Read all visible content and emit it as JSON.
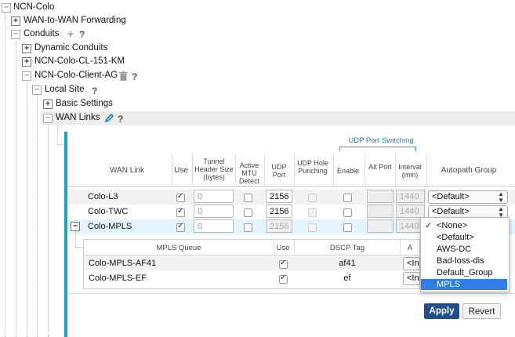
{
  "tree": {
    "root": "NCN-Colo",
    "wan_to_wan": "WAN-to-WAN Forwarding",
    "conduits": "Conduits",
    "dynamic_conduits": "Dynamic Conduits",
    "cl_151": "NCN-Colo-CL-151-KM",
    "client_ag": "NCN-Colo-Client-AG",
    "local_site": "Local Site",
    "basic_settings": "Basic Settings",
    "wan_links": "WAN Links",
    "help": "?",
    "plus": "+",
    "expand": "+",
    "collapse": "−"
  },
  "table": {
    "group_header": "UDP Port Switching",
    "headers": {
      "wan_link": "WAN Link",
      "use": "Use",
      "tunnel": "Tunnel Header Size (bytes)",
      "mtu": "Active MTU Detect",
      "udp_port": "UDP Port",
      "hole": "UDP Hole Punching",
      "enable": "Enable",
      "alt_port": "Alt Port",
      "interval": "Interval (min)",
      "autopath": "Autopath Group"
    },
    "rows": [
      {
        "name": "Colo-L3",
        "use": true,
        "tunnel": "0",
        "udp": "2156",
        "interval": "1440",
        "autopath": "<Default>"
      },
      {
        "name": "Colo-TWC",
        "use": true,
        "tunnel": "0",
        "udp": "2156",
        "interval": "1440",
        "autopath": "<Default>"
      },
      {
        "name": "Colo-MPLS",
        "use": true,
        "tunnel": "0",
        "udp": "2156",
        "interval": "1440",
        "autopath": ""
      }
    ]
  },
  "queue_table": {
    "headers": {
      "queue": "MPLS Queue",
      "use": "Use",
      "dscp": "DSCP Tag",
      "a": "A"
    },
    "rows": [
      {
        "name": "Colo-MPLS-AF41",
        "use": true,
        "dscp": "af41",
        "autopath": "<In"
      },
      {
        "name": "Colo-MPLS-EF",
        "use": true,
        "dscp": "ef",
        "autopath": "<In"
      }
    ]
  },
  "dropdown": {
    "checkmark": "✓",
    "options": [
      "<None>",
      "<Default>",
      "AWS-DC",
      "Bad-loss-dis",
      "Default_Group",
      "MPLS"
    ],
    "checked_index": 0,
    "highlighted_index": 5
  },
  "buttons": {
    "apply": "Apply",
    "revert": "Revert"
  },
  "colors": {
    "accent": "#17a8b8",
    "apply": "#1f4f8c",
    "highlight": "#2e7ee6"
  }
}
